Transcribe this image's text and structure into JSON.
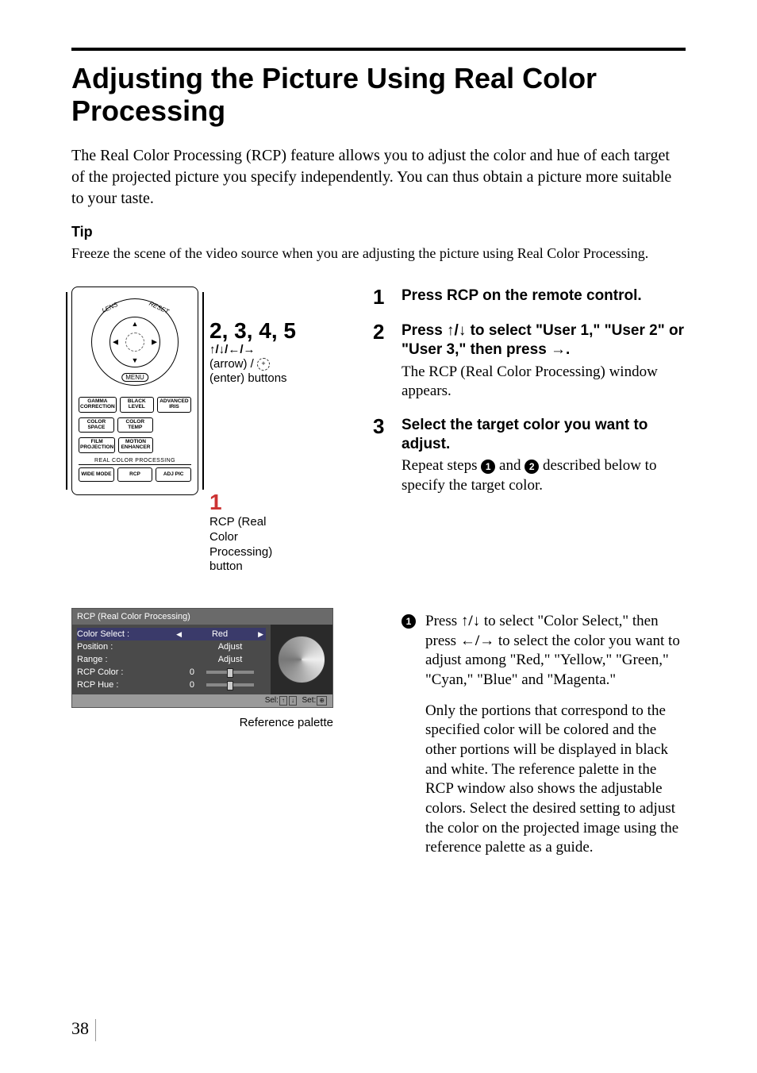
{
  "page_number": "38",
  "title": "Adjusting the Picture Using Real Color Processing",
  "intro": "The Real Color Processing (RCP) feature allows you to adjust the color and hue of each target of the projected picture you specify independently. You can thus obtain a picture more suitable to your taste.",
  "tip": {
    "heading": "Tip",
    "body": "Freeze the scene of the video source when you are adjusting the picture using Real Color Processing."
  },
  "remote": {
    "dpad": {
      "lens": "LENS",
      "reset": "RESET",
      "menu": "MENU"
    },
    "buttons_row1": [
      "GAMMA CORRECTION",
      "BLACK LEVEL",
      "ADVANCED IRIS"
    ],
    "buttons_row2": [
      "COLOR SPACE",
      "COLOR TEMP"
    ],
    "buttons_row3": [
      "FILM PROJECTION",
      "MOTION ENHANCER"
    ],
    "rcp_line": "REAL COLOR PROCESSING",
    "buttons_row4": [
      "WIDE MODE",
      "RCP",
      "ADJ PIC"
    ],
    "callout_a": {
      "numbers": "2, 3, 4, 5",
      "arrows": "↑/↓/←/→",
      "line1": "(arrow) / ",
      "line2": "(enter) buttons"
    },
    "callout_b": {
      "number": "1",
      "line1": "RCP (Real",
      "line2": "Color",
      "line3": "Processing)",
      "line4": "button"
    }
  },
  "osd": {
    "title": "RCP (Real Color Processing)",
    "rows": [
      {
        "label": "Color Select :",
        "value": "Red",
        "type": "select"
      },
      {
        "label": "Position :",
        "value": "Adjust",
        "type": "text"
      },
      {
        "label": "Range :",
        "value": "Adjust",
        "type": "text"
      },
      {
        "label": "RCP Color :",
        "num": "0",
        "type": "slider"
      },
      {
        "label": "RCP Hue :",
        "num": "0",
        "type": "slider"
      }
    ],
    "footer": {
      "sel": "Sel:",
      "set": "Set:"
    },
    "caption": "Reference palette"
  },
  "steps": [
    {
      "num": "1",
      "head": "Press RCP on the remote control."
    },
    {
      "num": "2",
      "head_pre": "Press ",
      "head_arrows": "↑/↓",
      "head_mid": " to select \"User 1,\" \"User 2\" or \"User 3,\" then press ",
      "head_arrow2": "→",
      "head_post": ".",
      "body": "The RCP (Real Color Processing) window appears."
    },
    {
      "num": "3",
      "head": "Select the target color you want to adjust.",
      "body_pre": "Repeat steps ",
      "body_mid": " and ",
      "body_post": " described below to specify the target color."
    }
  ],
  "substep": {
    "marker": "1",
    "p1_pre": "Press ",
    "p1_arrows": "↑/↓",
    "p1_mid": " to select \"Color Select,\" then press ",
    "p1_arrows2": "←/→",
    "p1_post": " to select the color you want to adjust among \"Red,\" \"Yellow,\" \"Green,\" \"Cyan,\" \"Blue\" and \"Magenta.\"",
    "p2": "Only the portions that correspond to the specified color will be colored and the other portions will be displayed in black and white. The reference palette in the RCP window also shows the adjustable colors. Select the desired setting to adjust the color on the projected image using the reference palette as a guide."
  }
}
